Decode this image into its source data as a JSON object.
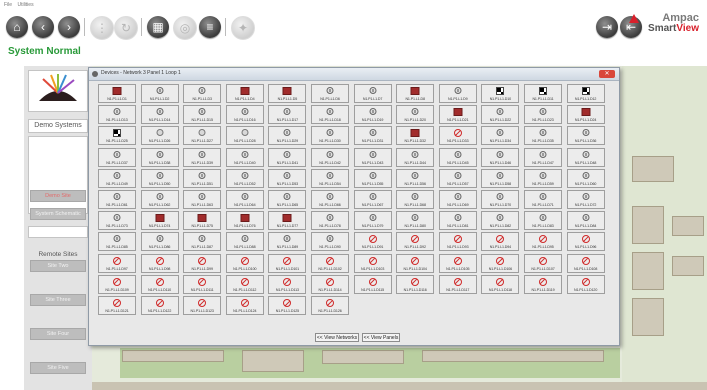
{
  "menu": [
    "File",
    "Utilities"
  ],
  "status": "System Normal",
  "brand": {
    "name": "Ampac",
    "product_prefix": "Smart",
    "product_suffix": "View",
    "accent": "#d8202b"
  },
  "toolbar": {
    "buttons": [
      {
        "icon": "home-icon",
        "glyph": "⌂",
        "enabled": true
      },
      {
        "icon": "back-icon",
        "glyph": "‹",
        "enabled": true
      },
      {
        "icon": "forward-icon",
        "glyph": "›",
        "enabled": true
      },
      {
        "icon": "tree-icon",
        "glyph": "⋮",
        "enabled": false
      },
      {
        "icon": "refresh-icon",
        "glyph": "↻",
        "enabled": false
      },
      {
        "icon": "grid-icon",
        "glyph": "▦",
        "enabled": true
      },
      {
        "icon": "target-icon",
        "glyph": "◎",
        "enabled": false
      },
      {
        "icon": "database-icon",
        "glyph": "≡",
        "enabled": true
      },
      {
        "icon": "compass-icon",
        "glyph": "✦",
        "enabled": false
      }
    ],
    "right_buttons": [
      {
        "icon": "login-icon",
        "glyph": "⇥"
      },
      {
        "icon": "logout-icon",
        "glyph": "⇤"
      }
    ]
  },
  "left_panel": {
    "system_label": "Demo Systems",
    "buttons": [
      "Demo Site",
      "System Schematic"
    ],
    "remote_label": "Remote Sites",
    "remote_buttons": [
      "Site Two",
      "Site Three",
      "Site Four",
      "Site Five"
    ]
  },
  "dialog": {
    "title": "Devices - Network 3 Panel 1 Loop 1",
    "close": "✕",
    "view_networks": "<< View Networks",
    "view_panels": "<< View Panels"
  },
  "devices": [
    {
      "label": "N1.P1.L1.D1",
      "icon": "module"
    },
    {
      "label": "N1.P1.L1.D2",
      "icon": "detector"
    },
    {
      "label": "N1.P1.L1.D3",
      "icon": "detector"
    },
    {
      "label": "N1.P1.L1.D4",
      "icon": "module"
    },
    {
      "label": "N1.P1.L1.D5",
      "icon": "module"
    },
    {
      "label": "N1.P1.L1.D6",
      "icon": "detector"
    },
    {
      "label": "N1.P1.L1.D7",
      "icon": "detector"
    },
    {
      "label": "N1.P1.L1.D8",
      "icon": "module"
    },
    {
      "label": "N1.P1.L1.D9",
      "icon": "detector"
    },
    {
      "label": "N1.P1.L1.D10",
      "icon": "checker"
    },
    {
      "label": "N1.P1.L1.D11",
      "icon": "checker"
    },
    {
      "label": "N1.P1.L1.D12",
      "icon": "checker"
    },
    {
      "label": "N1.P1.L1.D13",
      "icon": "detector"
    },
    {
      "label": "N1.P1.L1.D14",
      "icon": "detector"
    },
    {
      "label": "N1.P1.L1.D15",
      "icon": "detector"
    },
    {
      "label": "N1.P1.L1.D16",
      "icon": "detector"
    },
    {
      "label": "N1.P1.L1.D17",
      "icon": "detector"
    },
    {
      "label": "N1.P1.L1.D18",
      "icon": "detector"
    },
    {
      "label": "N1.P1.L1.D19",
      "icon": "detector"
    },
    {
      "label": "N1.P1.L1.D20",
      "icon": "detector"
    },
    {
      "label": "N1.P1.L1.D21",
      "icon": "module"
    },
    {
      "label": "N1.P1.L1.D22",
      "icon": "detector"
    },
    {
      "label": "N1.P1.L1.D23",
      "icon": "detector"
    },
    {
      "label": "N1.P1.L1.D24",
      "icon": "module"
    },
    {
      "label": "N1.P1.L1.D25",
      "icon": "checker"
    },
    {
      "label": "N1.P1.L1.D26",
      "icon": "trigger"
    },
    {
      "label": "N1.P1.L1.D27",
      "icon": "trigger"
    },
    {
      "label": "N1.P1.L1.D28",
      "icon": "trigger"
    },
    {
      "label": "N1.P1.L1.D29",
      "icon": "detector"
    },
    {
      "label": "N1.P1.L1.D30",
      "icon": "detector"
    },
    {
      "label": "N1.P1.L1.D31",
      "icon": "detector"
    },
    {
      "label": "N1.P1.L1.D32",
      "icon": "module"
    },
    {
      "label": "N1.P1.L1.D33",
      "icon": "disabled"
    },
    {
      "label": "N1.P1.L1.D34",
      "icon": "detector"
    },
    {
      "label": "N1.P1.L1.D35",
      "icon": "detector"
    },
    {
      "label": "N1.P1.L1.D36",
      "icon": "detector"
    },
    {
      "label": "N1.P1.L1.D37",
      "icon": "detector"
    },
    {
      "label": "N1.P1.L1.D38",
      "icon": "detector"
    },
    {
      "label": "N1.P1.L1.D39",
      "icon": "detector"
    },
    {
      "label": "N1.P1.L1.D40",
      "icon": "detector"
    },
    {
      "label": "N1.P1.L1.D41",
      "icon": "detector"
    },
    {
      "label": "N1.P1.L1.D42",
      "icon": "detector"
    },
    {
      "label": "N1.P1.L1.D43",
      "icon": "detector"
    },
    {
      "label": "N1.P1.L1.D44",
      "icon": "detector"
    },
    {
      "label": "N1.P1.L1.D45",
      "icon": "detector"
    },
    {
      "label": "N1.P1.L1.D46",
      "icon": "detector"
    },
    {
      "label": "N1.P1.L1.D47",
      "icon": "detector"
    },
    {
      "label": "N1.P1.L1.D48",
      "icon": "detector"
    },
    {
      "label": "N1.P1.L1.D49",
      "icon": "detector"
    },
    {
      "label": "N1.P1.L1.D50",
      "icon": "detector"
    },
    {
      "label": "N1.P1.L1.D51",
      "icon": "detector"
    },
    {
      "label": "N1.P1.L1.D52",
      "icon": "detector"
    },
    {
      "label": "N1.P1.L1.D53",
      "icon": "detector"
    },
    {
      "label": "N1.P1.L1.D54",
      "icon": "detector"
    },
    {
      "label": "N1.P1.L1.D55",
      "icon": "detector"
    },
    {
      "label": "N1.P1.L1.D56",
      "icon": "detector"
    },
    {
      "label": "N1.P1.L1.D57",
      "icon": "detector"
    },
    {
      "label": "N1.P1.L1.D58",
      "icon": "detector"
    },
    {
      "label": "N1.P1.L1.D59",
      "icon": "detector"
    },
    {
      "label": "N1.P1.L1.D60",
      "icon": "detector"
    },
    {
      "label": "N1.P1.L1.D61",
      "icon": "detector"
    },
    {
      "label": "N1.P1.L1.D62",
      "icon": "detector"
    },
    {
      "label": "N1.P1.L1.D63",
      "icon": "detector"
    },
    {
      "label": "N1.P1.L1.D64",
      "icon": "detector"
    },
    {
      "label": "N1.P1.L1.D65",
      "icon": "detector"
    },
    {
      "label": "N1.P1.L1.D66",
      "icon": "detector"
    },
    {
      "label": "N1.P1.L1.D67",
      "icon": "detector"
    },
    {
      "label": "N1.P1.L1.D68",
      "icon": "detector"
    },
    {
      "label": "N1.P1.L1.D69",
      "icon": "detector"
    },
    {
      "label": "N1.P1.L1.D70",
      "icon": "detector"
    },
    {
      "label": "N1.P1.L1.D71",
      "icon": "detector"
    },
    {
      "label": "N1.P1.L1.D72",
      "icon": "detector"
    },
    {
      "label": "N1.P1.L1.D73",
      "icon": "detector"
    },
    {
      "label": "N1.P1.L1.D74",
      "icon": "module"
    },
    {
      "label": "N1.P1.L1.D75",
      "icon": "module"
    },
    {
      "label": "N1.P1.L1.D76",
      "icon": "module"
    },
    {
      "label": "N1.P1.L1.D77",
      "icon": "module"
    },
    {
      "label": "N1.P1.L1.D78",
      "icon": "detector"
    },
    {
      "label": "N1.P1.L1.D79",
      "icon": "detector"
    },
    {
      "label": "N1.P1.L1.D80",
      "icon": "detector"
    },
    {
      "label": "N1.P1.L1.D81",
      "icon": "detector"
    },
    {
      "label": "N1.P1.L1.D82",
      "icon": "detector"
    },
    {
      "label": "N1.P1.L1.D83",
      "icon": "detector"
    },
    {
      "label": "N1.P1.L1.D84",
      "icon": "detector"
    },
    {
      "label": "N1.P1.L1.D85",
      "icon": "detector"
    },
    {
      "label": "N1.P1.L1.D86",
      "icon": "detector"
    },
    {
      "label": "N1.P1.L1.D87",
      "icon": "detector"
    },
    {
      "label": "N1.P1.L1.D88",
      "icon": "detector"
    },
    {
      "label": "N1.P1.L1.D89",
      "icon": "detector"
    },
    {
      "label": "N1.P1.L1.D90",
      "icon": "detector"
    },
    {
      "label": "N1.P1.L1.D91",
      "icon": "disabled"
    },
    {
      "label": "N1.P1.L1.D92",
      "icon": "disabled"
    },
    {
      "label": "N1.P1.L1.D93",
      "icon": "disabled"
    },
    {
      "label": "N1.P1.L1.D94",
      "icon": "disabled"
    },
    {
      "label": "N1.P1.L1.D95",
      "icon": "disabled"
    },
    {
      "label": "N1.P1.L1.D96",
      "icon": "disabled"
    },
    {
      "label": "N1.P1.L1.D97",
      "icon": "disabled"
    },
    {
      "label": "N1.P1.L1.D98",
      "icon": "disabled"
    },
    {
      "label": "N1.P1.L1.D99",
      "icon": "disabled"
    },
    {
      "label": "N1.P1.L1.D100",
      "icon": "disabled"
    },
    {
      "label": "N1.P1.L1.D101",
      "icon": "disabled"
    },
    {
      "label": "N1.P1.L1.D102",
      "icon": "disabled"
    },
    {
      "label": "N1.P1.L1.D103",
      "icon": "disabled"
    },
    {
      "label": "N1.P1.L1.D104",
      "icon": "disabled"
    },
    {
      "label": "N1.P1.L1.D105",
      "icon": "disabled"
    },
    {
      "label": "N1.P1.L1.D106",
      "icon": "disabled"
    },
    {
      "label": "N1.P1.L1.D107",
      "icon": "disabled"
    },
    {
      "label": "N1.P1.L1.D108",
      "icon": "disabled"
    },
    {
      "label": "N1.P1.L1.D109",
      "icon": "disabled"
    },
    {
      "label": "N1.P1.L1.D110",
      "icon": "disabled"
    },
    {
      "label": "N1.P1.L1.D111",
      "icon": "disabled"
    },
    {
      "label": "N1.P1.L1.D112",
      "icon": "disabled"
    },
    {
      "label": "N1.P1.L1.D113",
      "icon": "disabled"
    },
    {
      "label": "N1.P1.L1.D114",
      "icon": "disabled"
    },
    {
      "label": "N1.P1.L1.D115",
      "icon": "disabled"
    },
    {
      "label": "N1.P1.L1.D116",
      "icon": "disabled"
    },
    {
      "label": "N1.P1.L1.D117",
      "icon": "disabled"
    },
    {
      "label": "N1.P1.L1.D118",
      "icon": "disabled"
    },
    {
      "label": "N1.P1.L1.D119",
      "icon": "disabled"
    },
    {
      "label": "N1.P1.L1.D120",
      "icon": "disabled"
    },
    {
      "label": "N1.P1.L1.D121",
      "icon": "disabled"
    },
    {
      "label": "N1.P1.L1.D122",
      "icon": "disabled"
    },
    {
      "label": "N1.P1.L1.D123",
      "icon": "disabled"
    },
    {
      "label": "N1.P1.L1.D124",
      "icon": "disabled"
    },
    {
      "label": "N1.P1.L1.D125",
      "icon": "disabled"
    },
    {
      "label": "N1.P1.L1.D126",
      "icon": "disabled"
    }
  ],
  "colors": {
    "status_ok": "#2a9a3a",
    "module": "#a12c2c",
    "disabled": "#d02a2a",
    "remote_btn_text": "#e26a6a"
  }
}
